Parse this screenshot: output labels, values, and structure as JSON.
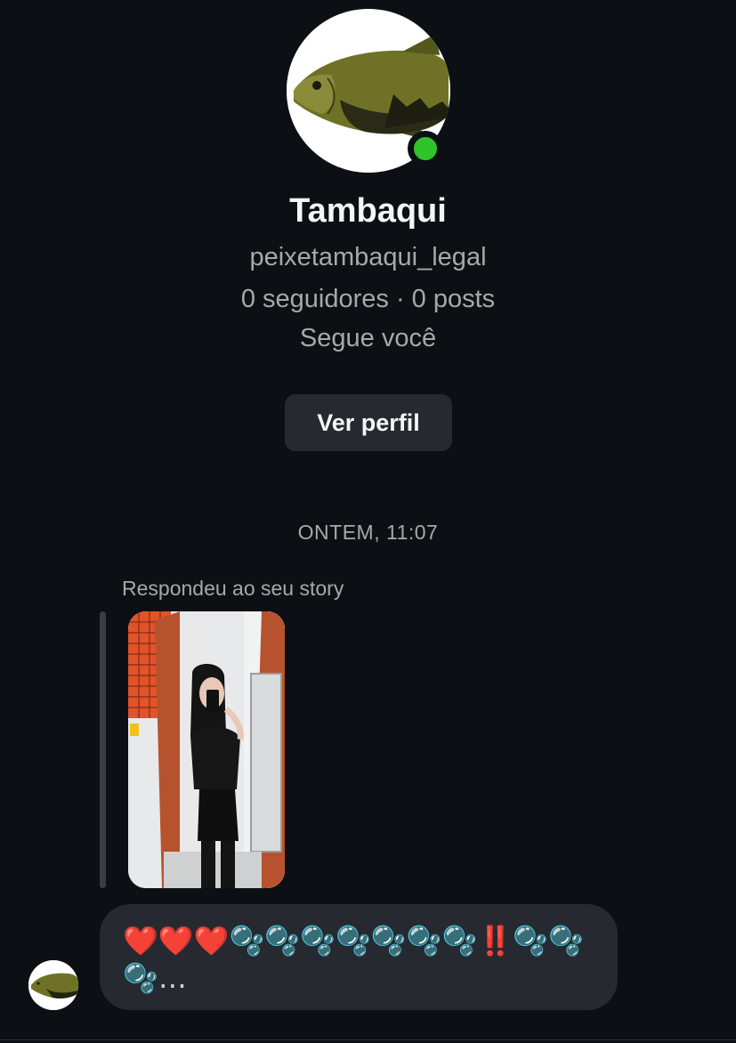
{
  "profile": {
    "name": "Tambaqui",
    "username": "peixetambaqui_legal",
    "stats": "0 seguidores · 0 posts",
    "follow_status": "Segue você",
    "online": true,
    "view_profile_label": "Ver perfil"
  },
  "conversation": {
    "timestamp": "ONTEM, 11:07",
    "reply_label": "Respondeu ao seu story",
    "message": {
      "hearts": "❤️❤️❤️",
      "body": "🫧🫧🫧🫧🫧🫧🫧‼️🫧🫧🫧…"
    }
  },
  "colors": {
    "background": "#0c1014",
    "bubble": "#262a30",
    "secondary_text": "#a8a8a8",
    "online_dot": "#2ec52a"
  }
}
